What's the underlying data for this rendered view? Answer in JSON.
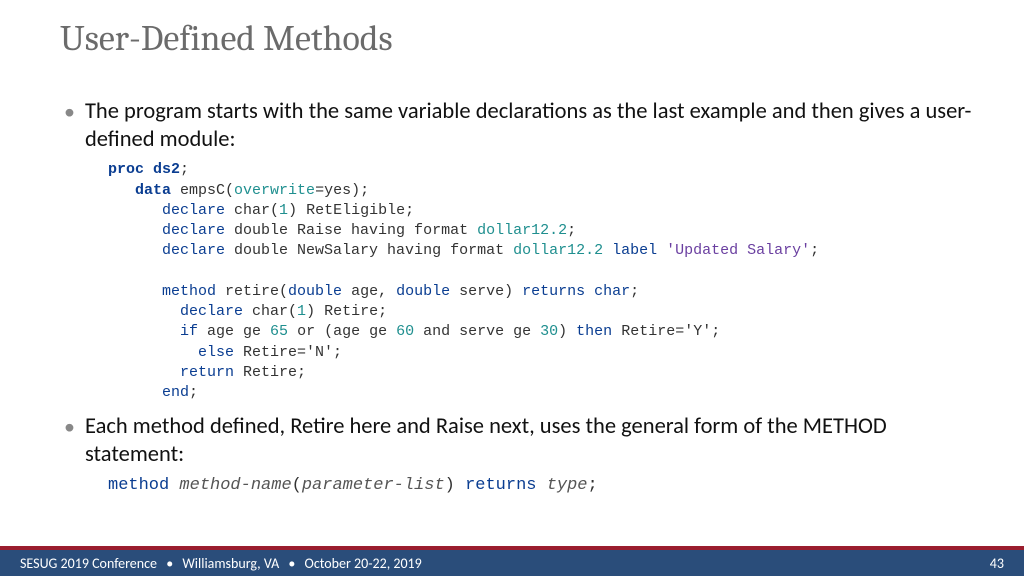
{
  "title": "User-Defined Methods",
  "bullets": [
    "The program starts with the same variable declarations as the last example and then gives a user-defined module:",
    "Each method defined, Retire here and Raise next, uses the general form of the METHOD statement:"
  ],
  "code": {
    "l1a": "proc ds2",
    "l1b": ";",
    "l2a": "data",
    "l2b": " empsC(",
    "l2c": "overwrite",
    "l2d": "=yes);",
    "l3a": "declare",
    "l3b": " char(",
    "l3c": "1",
    "l3d": ") RetEligible;",
    "l4a": "declare",
    "l4b": " double Raise having format ",
    "l4c": "dollar12.2",
    "l4d": ";",
    "l5a": "declare",
    "l5b": " double NewSalary having format ",
    "l5c": "dollar12.2",
    "l5d": " label ",
    "l5e": "'Updated Salary'",
    "l5f": ";",
    "l6a": "method",
    "l6b": " retire(",
    "l6c": "double",
    "l6d": " age, ",
    "l6e": "double",
    "l6f": " serve) ",
    "l6g": "returns char",
    "l6h": ";",
    "l7a": "declare",
    "l7b": " char(",
    "l7c": "1",
    "l7d": ") Retire;",
    "l8a": "if",
    "l8b": " age ge ",
    "l8c": "65",
    "l8d": " or (age ge ",
    "l8e": "60",
    "l8f": " and serve ge ",
    "l8g": "30",
    "l8h": ") ",
    "l8i": "then",
    "l8j": " Retire='Y';",
    "l9a": "else",
    "l9b": " Retire='N';",
    "l10a": "return",
    "l10b": " Retire;",
    "l11a": "end",
    "l11b": ";"
  },
  "syntax": {
    "a": "method",
    "b": "method-name",
    "c": "(",
    "d": "parameter-list",
    "e": ") ",
    "f": "returns",
    "g": " ",
    "h": "type",
    "i": ";"
  },
  "footer": {
    "conf": "SESUG 2019 Conference",
    "loc": "Williamsburg, VA",
    "date": "October 20-22, 2019",
    "page": "43",
    "bullet": "•"
  }
}
